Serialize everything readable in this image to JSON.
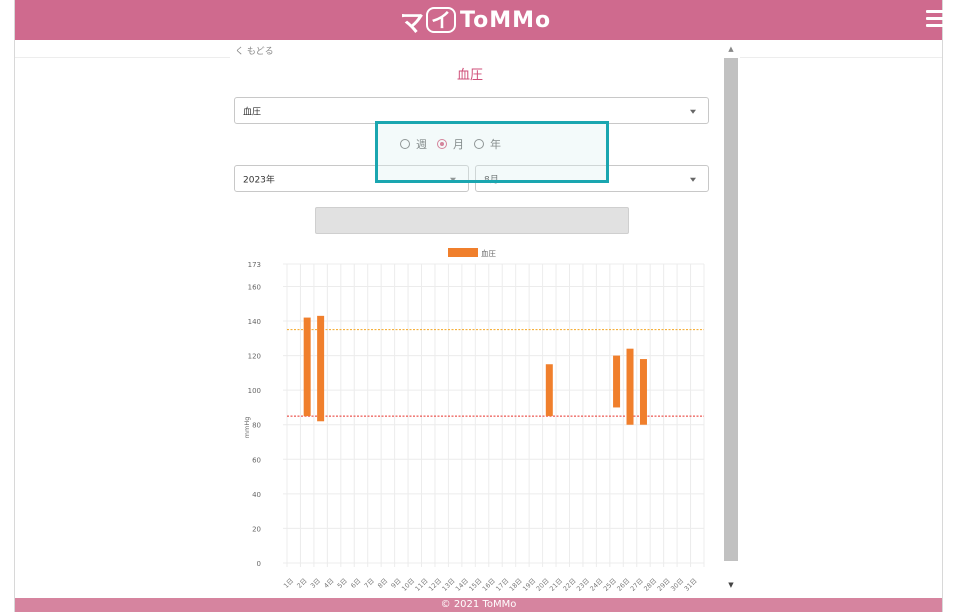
{
  "header": {
    "logo_prefix": "マ",
    "logo_box": "イ",
    "logo_name": "ToMMo"
  },
  "nav": {
    "back_label": "く もどる"
  },
  "page": {
    "title": "血圧"
  },
  "category_select": {
    "value": "血圧"
  },
  "period_radios": [
    {
      "label": "週",
      "checked": false
    },
    {
      "label": "月",
      "checked": true
    },
    {
      "label": "年",
      "checked": false
    }
  ],
  "year_select": {
    "value": "2023年"
  },
  "month_select": {
    "value": "8月"
  },
  "footer": {
    "copyright": "© 2021 ToMMo"
  },
  "colors": {
    "accent": "#cf6a8e",
    "bar": "#f07f2c",
    "upper_line": "#f5a623",
    "lower_line": "#e8312a",
    "highlight": "#1aa6b0"
  },
  "chart_data": {
    "type": "bar",
    "legend": [
      "血圧"
    ],
    "ylabel": "mmHg",
    "ylim": [
      0,
      173
    ],
    "yticks": [
      "0",
      "20",
      "40",
      "60",
      "80",
      "100",
      "120",
      "140",
      "160",
      "173"
    ],
    "categories": [
      "1日",
      "2日",
      "3日",
      "4日",
      "5日",
      "6日",
      "7日",
      "8日",
      "9日",
      "10日",
      "11日",
      "12日",
      "13日",
      "14日",
      "15日",
      "16日",
      "17日",
      "18日",
      "19日",
      "20日",
      "21日",
      "22日",
      "23日",
      "24日",
      "25日",
      "26日",
      "27日",
      "28日",
      "29日",
      "30日",
      "31日"
    ],
    "series": [
      {
        "name": "血圧",
        "ranges": [
          [
            2,
            85,
            142
          ],
          [
            3,
            82,
            143
          ],
          [
            20,
            85,
            115
          ],
          [
            25,
            90,
            120
          ],
          [
            26,
            80,
            124
          ],
          [
            27,
            80,
            118
          ]
        ]
      }
    ],
    "reference_lines": [
      {
        "value": 135
      },
      {
        "value": 85
      }
    ],
    "grid": true
  }
}
